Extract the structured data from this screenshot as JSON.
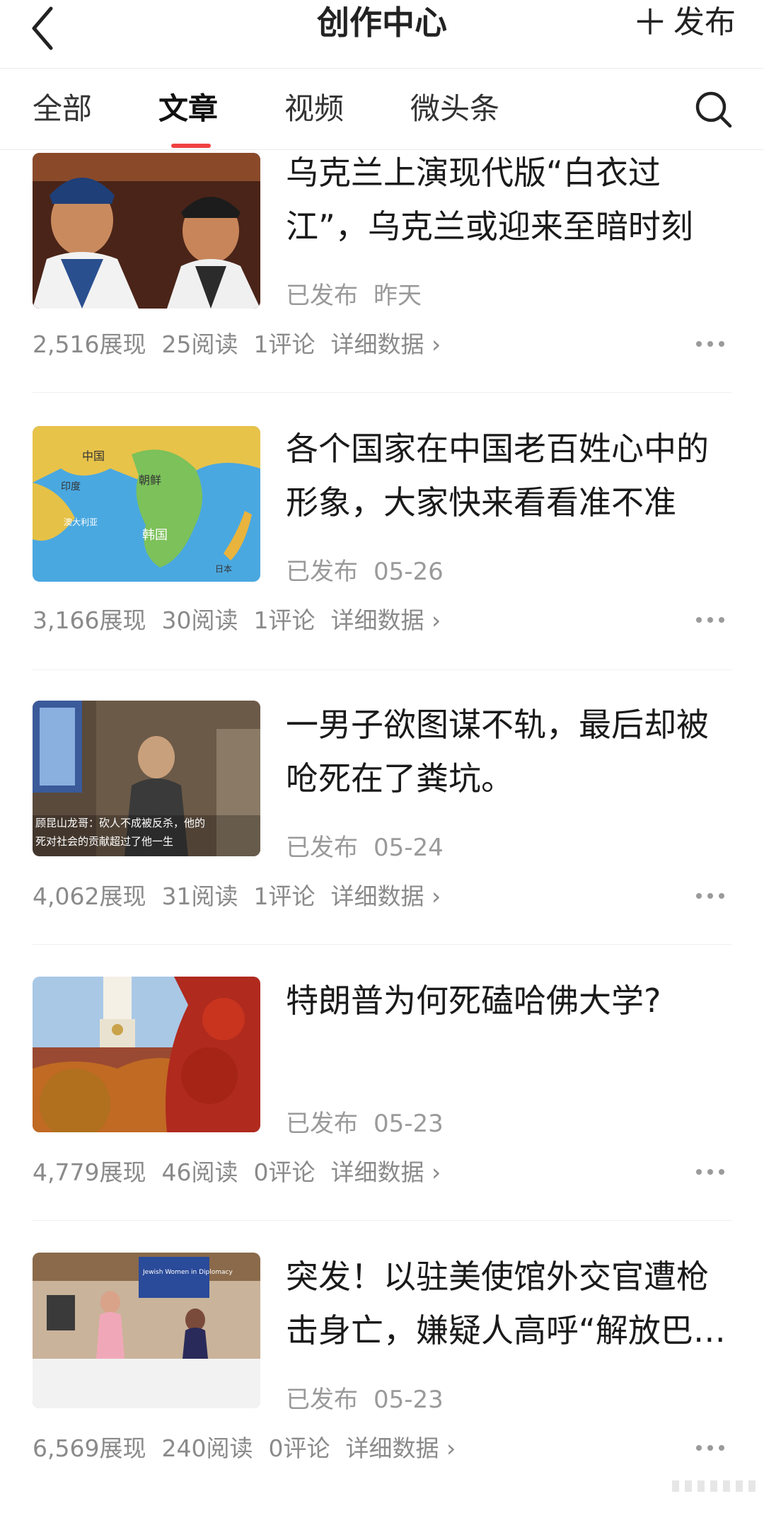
{
  "header": {
    "title": "创作中心",
    "publish_label": "发布"
  },
  "tabs": [
    {
      "label": "全部"
    },
    {
      "label": "文章"
    },
    {
      "label": "视频"
    },
    {
      "label": "微头条"
    }
  ],
  "articles": [
    {
      "title": "乌克兰上演现代版“白衣过江”，乌克兰或迎来至暗时刻",
      "status": "已发布",
      "date": "昨天",
      "impressions": "2,516展现",
      "reads": "25阅读",
      "comments": "1评论",
      "detail_label": "详细数据"
    },
    {
      "title": "各个国家在中国老百姓心中的形象，大家快来看看准不准",
      "status": "已发布",
      "date": "05-26",
      "impressions": "3,166展现",
      "reads": "30阅读",
      "comments": "1评论",
      "detail_label": "详细数据",
      "thumb_labels": [
        "中国",
        "印度",
        "朝鲜",
        "澳大利亚",
        "韩国",
        "日本"
      ]
    },
    {
      "title": "一男子欲图谋不轨，最后却被呛死在了粪坑。",
      "status": "已发布",
      "date": "05-24",
      "impressions": "4,062展现",
      "reads": "31阅读",
      "comments": "1评论",
      "detail_label": "详细数据",
      "thumb_caption_1": "顾昆山龙哥：砍人不成被反杀，他的",
      "thumb_caption_2": "死对社会的贡献超过了他一生"
    },
    {
      "title": "特朗普为何死磕哈佛大学?",
      "status": "已发布",
      "date": "05-23",
      "impressions": "4,779展现",
      "reads": "46阅读",
      "comments": "0评论",
      "detail_label": "详细数据"
    },
    {
      "title": "突发！以驻美使馆外交官遭枪击身亡，嫌疑人高呼“解放巴勒斯坦”",
      "status": "已发布",
      "date": "05-23",
      "impressions": "6,569展现",
      "reads": "240阅读",
      "comments": "0评论",
      "detail_label": "详细数据",
      "thumb_screen_text": "Jewish Women in Diplomacy"
    }
  ],
  "colors": {
    "accent": "#f04142",
    "text_primary": "#1a1a1a",
    "text_secondary": "#9a9a9a"
  },
  "icons": [
    "back-arrow-icon",
    "plus-icon",
    "search-icon",
    "chevron-right-icon",
    "more-dots-icon"
  ]
}
